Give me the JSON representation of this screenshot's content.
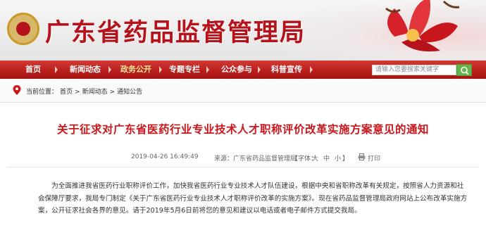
{
  "header": {
    "site_title": "广东省药品监督管理局"
  },
  "nav": {
    "items": [
      {
        "label": "首页",
        "active": false
      },
      {
        "label": "新闻动态",
        "active": false
      },
      {
        "label": "政务公开",
        "active": true
      },
      {
        "label": "专题专栏",
        "active": false
      },
      {
        "label": "公众参与",
        "active": false
      },
      {
        "label": "科普宣传",
        "active": false
      }
    ],
    "search_placeholder": "请输入您要搜索关键字"
  },
  "breadcrumb": {
    "prefix": "当前位置：",
    "items": [
      "首页",
      "新闻动态",
      "通知公告"
    ],
    "separator": ">"
  },
  "article": {
    "title": "关于征求对广东省医药行业专业技术人才职称评价改革实施方案意见的通知",
    "date": "2019-04-26 16:49:49",
    "source": "来源：广东省药品监督管理局",
    "font_size_label": "【字体：",
    "font_large": "大",
    "font_medium": "中",
    "font_small": "小",
    "font_size_close": "】",
    "print_label": "打印",
    "paragraphs": [
      "为全面推进我省医药行业职称评价工作，加快我省医药行业专业技术人才队伍建设，根据中央和省职称改革有关规定，按照省人力资源和社会保障厅要求，我局专门制定《关于广东省医药行业专业技术人才职称评价改革的实施方案》。现在省药品监督管理局政府网站上公布改革实施方案，公开征求社会各界的意见。请于2019年5月6日前将您的意见和建议以电话或者电子邮件方式提交我局。"
    ]
  },
  "colors": {
    "brand_red": "#b5121b",
    "nav_red": "#b91f1c",
    "title_red": "#c8161d",
    "search_green": "#67b44c"
  }
}
